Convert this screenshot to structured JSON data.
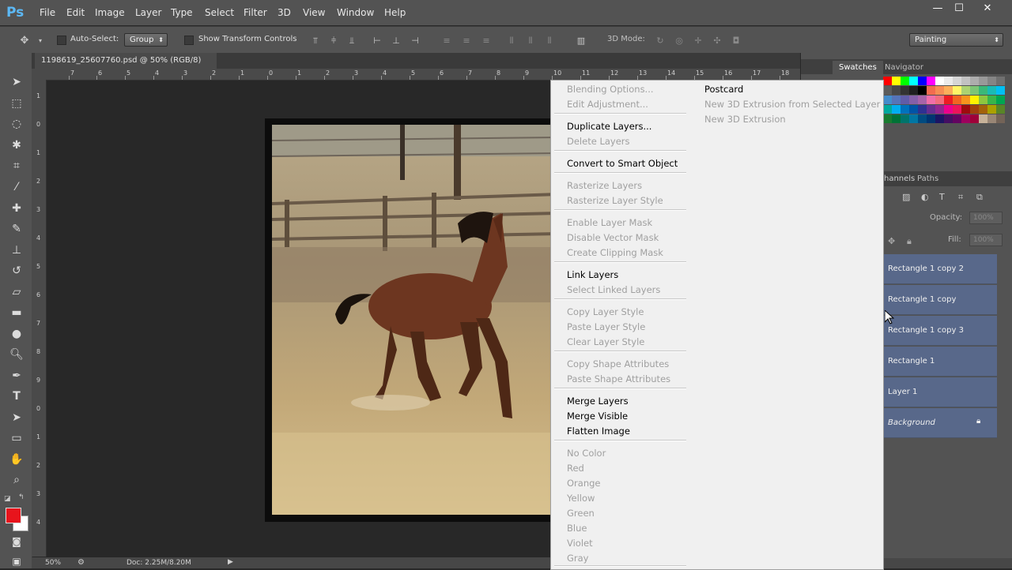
{
  "app": {
    "logo": "Ps"
  },
  "menubar": {
    "items": [
      "File",
      "Edit",
      "Image",
      "Layer",
      "Type",
      "Select",
      "Filter",
      "3D",
      "View",
      "Window",
      "Help"
    ]
  },
  "window_controls": {
    "minimize": "—",
    "maximize": "☐",
    "close": "✕"
  },
  "options_bar": {
    "auto_select_label": "Auto-Select:",
    "auto_select_value": "Group",
    "show_transform_label": "Show Transform Controls",
    "three_d_mode_label": "3D Mode:",
    "workspace_value": "Painting"
  },
  "document_tab": {
    "title": "1198619_25607760.psd @ 50% (RGB/8)",
    "close": "×"
  },
  "ruler": {
    "top_labels": [
      "7",
      "6",
      "5",
      "4",
      "3",
      "2",
      "1",
      "0",
      "1",
      "2",
      "3",
      "4",
      "5",
      "6",
      "7",
      "8",
      "9",
      "10",
      "11",
      "12",
      "13",
      "14",
      "15",
      "16",
      "17",
      "18"
    ],
    "left_labels": [
      "1",
      "0",
      "1",
      "2",
      "3",
      "4",
      "5",
      "6",
      "7",
      "8",
      "9",
      "0",
      "1",
      "2",
      "3",
      "4"
    ]
  },
  "status_bar": {
    "zoom": "50%",
    "doc": "Doc: 2.25M/8.20M"
  },
  "panels": {
    "swatches_tab": "Swatches",
    "navigator_tab": "Navigator",
    "channels_tab": "Channels",
    "paths_tab": "Paths",
    "opacity_label": "Opacity:",
    "opacity_value": "100%",
    "fill_label": "Fill:",
    "fill_value": "100%"
  },
  "layers": [
    {
      "name": "Rectangle 1 copy 2"
    },
    {
      "name": "Rectangle 1 copy"
    },
    {
      "name": "Rectangle 1 copy 3"
    },
    {
      "name": "Rectangle 1"
    },
    {
      "name": "Layer 1"
    },
    {
      "name": "Background"
    }
  ],
  "context_menu": {
    "items": [
      {
        "label": "Blending Options...",
        "enabled": false
      },
      {
        "label": "Edit Adjustment...",
        "enabled": false
      },
      {
        "label": "Duplicate Layers...",
        "enabled": true
      },
      {
        "label": "Delete Layers",
        "enabled": false
      },
      {
        "label": "Convert to Smart Object",
        "enabled": true
      },
      {
        "label": "Rasterize Layers",
        "enabled": false
      },
      {
        "label": "Rasterize Layer Style",
        "enabled": false
      },
      {
        "label": "Enable Layer Mask",
        "enabled": false
      },
      {
        "label": "Disable Vector Mask",
        "enabled": false
      },
      {
        "label": "Create Clipping Mask",
        "enabled": false
      },
      {
        "label": "Link Layers",
        "enabled": true
      },
      {
        "label": "Select Linked Layers",
        "enabled": false
      },
      {
        "label": "Copy Layer Style",
        "enabled": false
      },
      {
        "label": "Paste Layer Style",
        "enabled": false
      },
      {
        "label": "Clear Layer Style",
        "enabled": false
      },
      {
        "label": "Copy Shape Attributes",
        "enabled": false
      },
      {
        "label": "Paste Shape Attributes",
        "enabled": false
      },
      {
        "label": "Merge Layers",
        "enabled": true
      },
      {
        "label": "Merge Visible",
        "enabled": true
      },
      {
        "label": "Flatten Image",
        "enabled": true
      },
      {
        "label": "No Color",
        "enabled": false
      },
      {
        "label": "Red",
        "enabled": false
      },
      {
        "label": "Orange",
        "enabled": false
      },
      {
        "label": "Yellow",
        "enabled": false
      },
      {
        "label": "Green",
        "enabled": false
      },
      {
        "label": "Blue",
        "enabled": false
      },
      {
        "label": "Violet",
        "enabled": false
      },
      {
        "label": "Gray",
        "enabled": false
      }
    ],
    "submenu": [
      {
        "label": "Postcard",
        "enabled": true
      },
      {
        "label": "New 3D Extrusion from Selected Layer",
        "enabled": false
      },
      {
        "label": "New 3D Extrusion",
        "enabled": false
      }
    ]
  },
  "colors": {
    "foreground": "#e8141c",
    "background": "#ffffff",
    "layer_selected": "#58688a"
  }
}
